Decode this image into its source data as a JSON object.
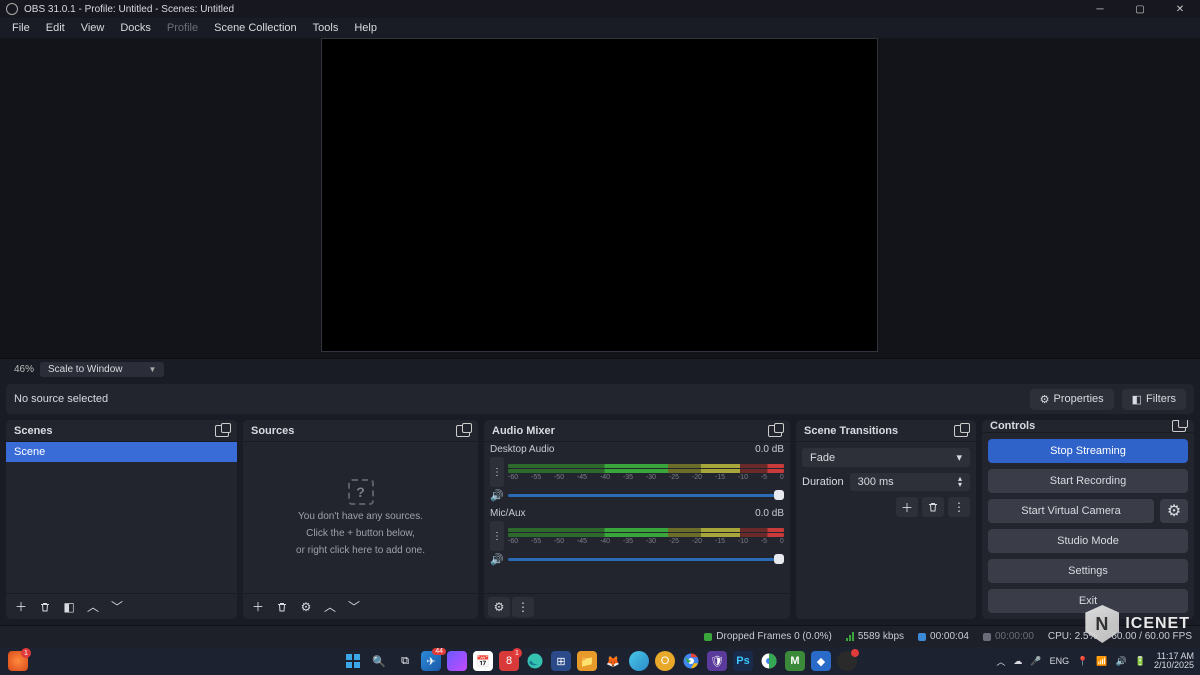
{
  "title": "OBS 31.0.1 - Profile: Untitled - Scenes: Untitled",
  "menu": {
    "file": "File",
    "edit": "Edit",
    "view": "View",
    "docks": "Docks",
    "profile": "Profile",
    "scene_collection": "Scene Collection",
    "tools": "Tools",
    "help": "Help"
  },
  "zoom": {
    "pct": "46%",
    "mode": "Scale to Window"
  },
  "srcbar": {
    "label": "No source selected",
    "properties": "Properties",
    "filters": "Filters"
  },
  "docks": {
    "scenes": {
      "title": "Scenes",
      "items": [
        "Scene"
      ]
    },
    "sources": {
      "title": "Sources",
      "empty_l1": "You don't have any sources.",
      "empty_l2": "Click the + button below,",
      "empty_l3": "or right click here to add one."
    },
    "mixer": {
      "title": "Audio Mixer",
      "channels": [
        {
          "name": "Desktop Audio",
          "level": "0.0 dB"
        },
        {
          "name": "Mic/Aux",
          "level": "0.0 dB"
        }
      ],
      "ticks": [
        "-60",
        "-55",
        "-50",
        "-45",
        "-40",
        "-35",
        "-30",
        "-25",
        "-20",
        "-15",
        "-10",
        "-5",
        "0"
      ]
    },
    "trans": {
      "title": "Scene Transitions",
      "selected": "Fade",
      "duration_label": "Duration",
      "duration_value": "300 ms"
    },
    "controls": {
      "title": "Controls",
      "stop_streaming": "Stop Streaming",
      "start_recording": "Start Recording",
      "virtual_camera": "Start Virtual Camera",
      "studio_mode": "Studio Mode",
      "settings": "Settings",
      "exit": "Exit"
    }
  },
  "status": {
    "dropped": "Dropped Frames 0 (0.0%)",
    "bitrate": "5589 kbps",
    "live_time": "00:00:04",
    "rec_time": "00:00:00",
    "cpu": "CPU: 2.5%",
    "fps": "60.00 / 60.00 FPS"
  },
  "taskbar": {
    "time": "11:17 AM",
    "date": "2/10/2025",
    "lang": "ENG"
  },
  "watermark": "ICENET"
}
